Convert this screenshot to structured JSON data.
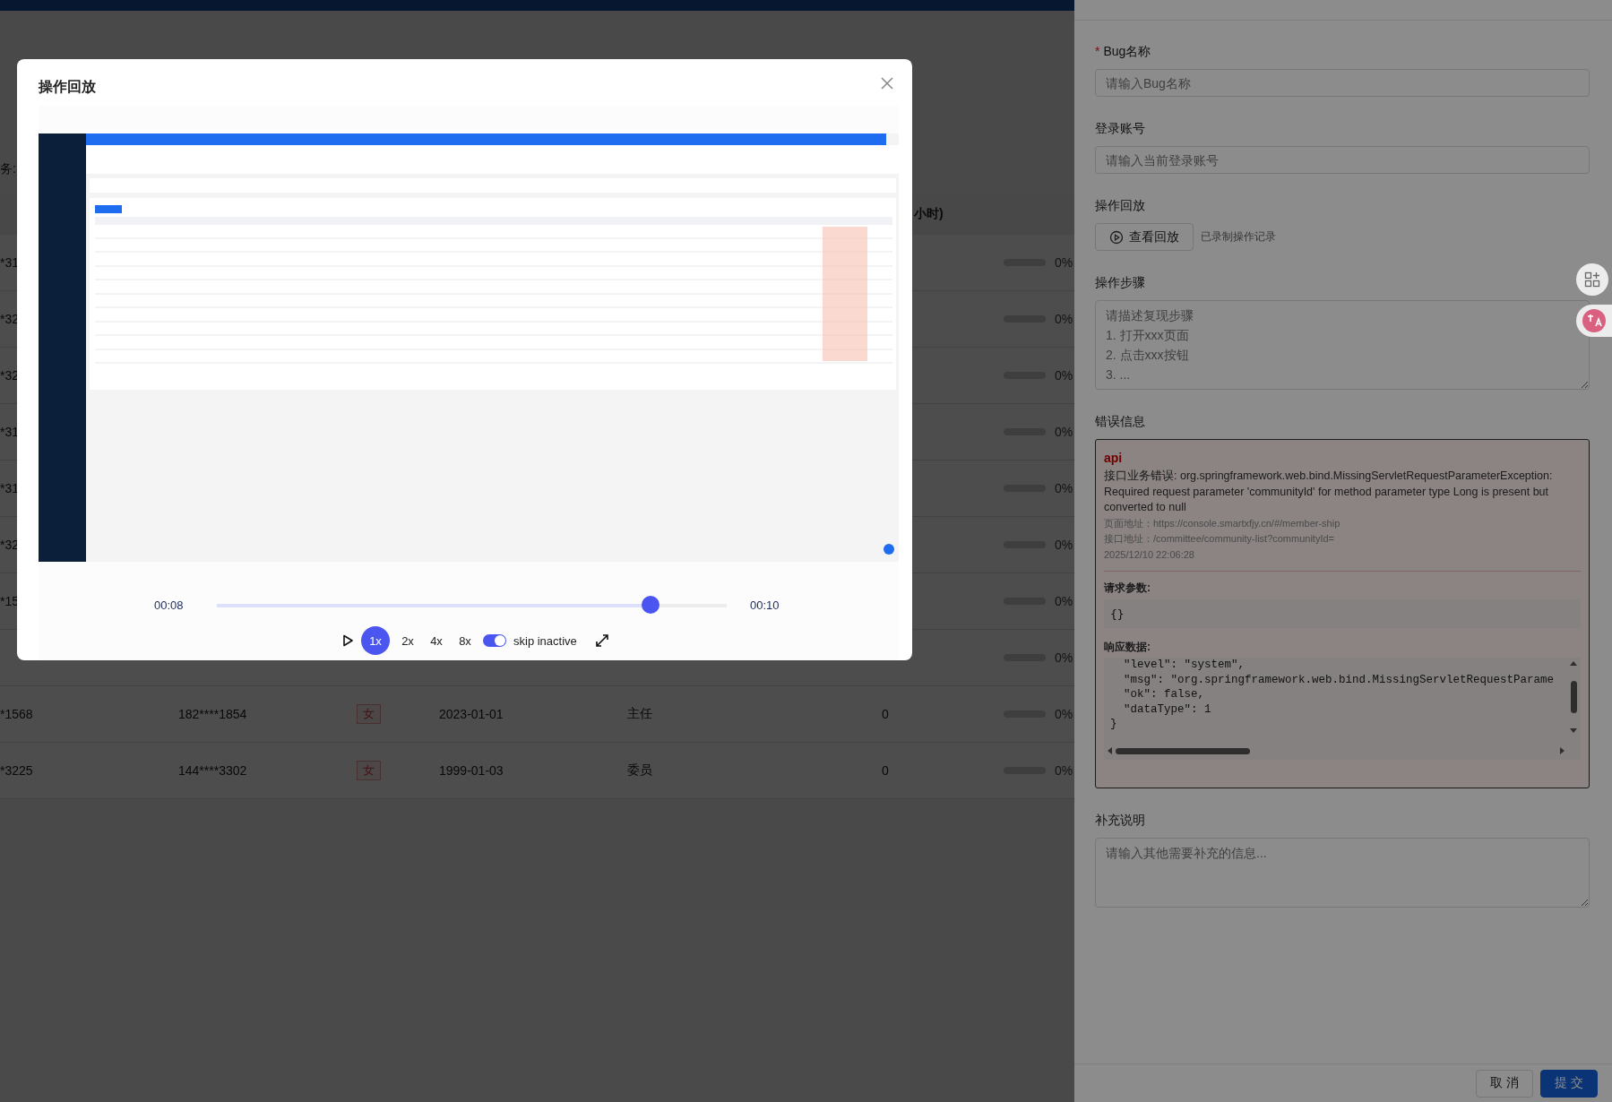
{
  "page": {
    "section_label": "务:",
    "table": {
      "header_fragment": "小时)",
      "rows": [
        {
          "id": "*31",
          "level": 0,
          "percent": "0%"
        },
        {
          "id": "*32",
          "level": 0,
          "percent": "0%"
        },
        {
          "id": "*32",
          "level": 0,
          "percent": "0%"
        },
        {
          "id": "*31",
          "level": 0,
          "percent": "0%"
        },
        {
          "id": "*31",
          "level": 0,
          "percent": "0%"
        },
        {
          "id": "*32",
          "level": 0,
          "percent": "0%"
        },
        {
          "id": "*15",
          "level": 0,
          "percent": "0%"
        },
        {
          "level": 0,
          "percent": "0%"
        },
        {
          "id": "*1568",
          "phone": "182****1854",
          "gender": "女",
          "date": "2023-01-01",
          "role": "主任",
          "count": "0",
          "level": 0,
          "percent": "0%"
        },
        {
          "id": "*3225",
          "phone": "144****3302",
          "gender": "女",
          "date": "1999-01-03",
          "role": "委员",
          "count": "0",
          "level": 0,
          "percent": "0%"
        }
      ]
    }
  },
  "drawer": {
    "fields": [
      {
        "kind": "input",
        "required_mark": "*",
        "label": "Bug名称",
        "placeholder": "请输入Bug名称"
      },
      {
        "kind": "input",
        "label": "登录账号",
        "placeholder": "请输入当前登录账号"
      },
      {
        "kind": "replay",
        "label": "操作回放",
        "button": "查看回放",
        "note": "已录制操作记录"
      },
      {
        "kind": "textarea",
        "label": "操作步骤",
        "placeholder": "请描述复现步骤\n1. 打开xxx页面\n2. 点击xxx按钮\n3. ..."
      },
      {
        "kind": "error",
        "label": "错误信息",
        "source": "api",
        "message": "接口业务错误: org.springframework.web.bind.MissingServletRequestParameterException: Required request parameter 'communityId' for method parameter type Long is present but converted to null",
        "page_url_label": "页面地址：",
        "page_url": "https://console.smartxfjy.cn/#/member-ship",
        "api_url_label": "接口地址：",
        "api_url": "/committee/community-list?communityId=",
        "time": "2025/12/10 22:06:28",
        "params_label": "请求参数:",
        "params": "{}",
        "response_label": "响应数据:",
        "response": "  \"level\": \"system\",\n  \"msg\": \"org.springframework.web.bind.MissingServletRequestParame\n  \"ok\": false,\n  \"dataType\": 1\n}"
      },
      {
        "kind": "textarea",
        "label": "补充说明",
        "placeholder": "请输入其他需要补充的信息..."
      }
    ],
    "buttons": [
      {
        "label": "取 消",
        "primary": false
      },
      {
        "label": "提 交",
        "primary": true
      }
    ]
  },
  "modal": {
    "title": "操作回放",
    "player": {
      "current_time": "00:08",
      "total_time": "00:10",
      "level": 0.85,
      "speeds": [
        {
          "label": "1x",
          "selected": true
        },
        {
          "label": "2x",
          "selected": false
        },
        {
          "label": "4x",
          "selected": false
        },
        {
          "label": "8x",
          "selected": false
        }
      ],
      "skip_inactive": {
        "label": "skip inactive",
        "on": true
      }
    }
  }
}
